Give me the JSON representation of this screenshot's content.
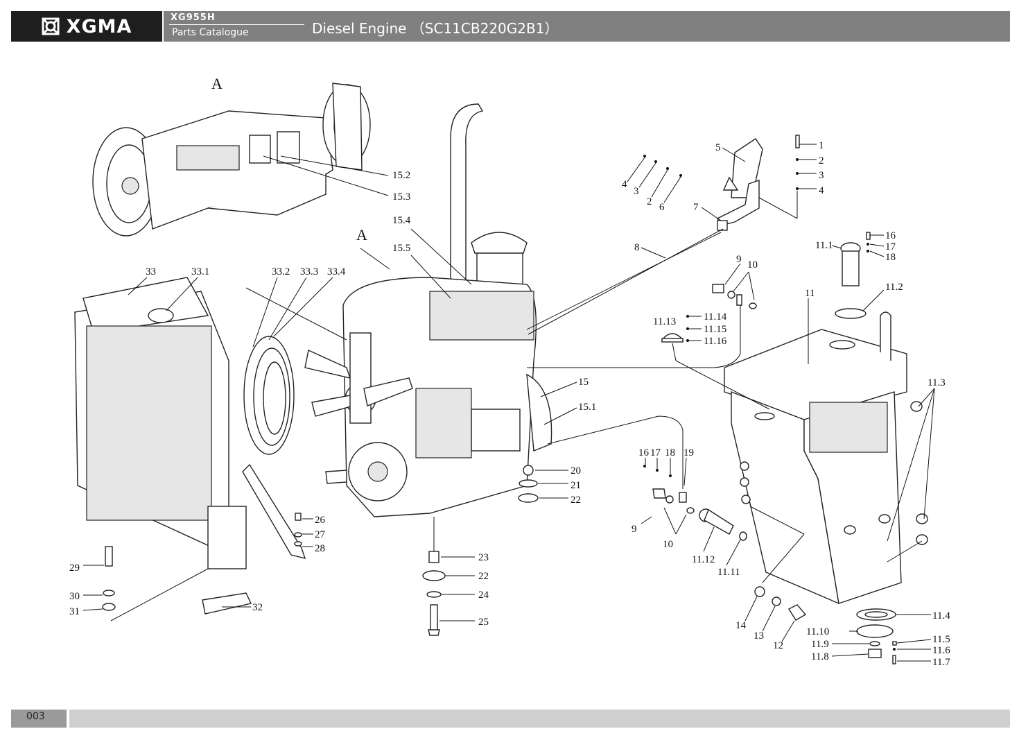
{
  "header": {
    "brand": "XGMA",
    "model": "XG955H",
    "catalogue": "Parts Catalogue",
    "title": "Diesel Engine （SC11CB220G2B1）"
  },
  "footer": {
    "page": "003"
  },
  "diagram": {
    "view_label": "A",
    "labels": {
      "l1": "1",
      "l2": "2",
      "l3": "3",
      "l4": "4",
      "l4b": "4",
      "l3b": "3",
      "l2b": "2",
      "l5": "5",
      "l6": "6",
      "l7": "7",
      "l8": "8",
      "l9": "9",
      "l10": "10",
      "l9b": "9",
      "l10b": "10",
      "l11": "11",
      "l11_1": "11.1",
      "l11_2": "11.2",
      "l11_3": "11.3",
      "l11_4": "11.4",
      "l11_5": "11.5",
      "l11_6": "11.6",
      "l11_7": "11.7",
      "l11_8": "11.8",
      "l11_9": "11.9",
      "l11_10": "11.10",
      "l11_11": "11.11",
      "l11_12": "11.12",
      "l11_13": "11.13",
      "l11_14": "11.14",
      "l11_15": "11.15",
      "l11_16": "11.16",
      "l12": "12",
      "l13": "13",
      "l14": "14",
      "l15": "15",
      "l15_1": "15.1",
      "l15_2": "15.2",
      "l15_3": "15.3",
      "l15_4": "15.4",
      "l15_5": "15.5",
      "l16": "16",
      "l17": "17",
      "l18": "18",
      "l16b": "16",
      "l17b": "17",
      "l18b": "18",
      "l19": "19",
      "l20": "20",
      "l21": "21",
      "l22": "22",
      "l22b": "22",
      "l23": "23",
      "l24": "24",
      "l25": "25",
      "l26": "26",
      "l27": "27",
      "l28": "28",
      "l29": "29",
      "l30": "30",
      "l31": "31",
      "l32": "32",
      "l33": "33",
      "l33_1": "33.1",
      "l33_2": "33.2",
      "l33_3": "33.3",
      "l33_4": "33.4"
    }
  }
}
